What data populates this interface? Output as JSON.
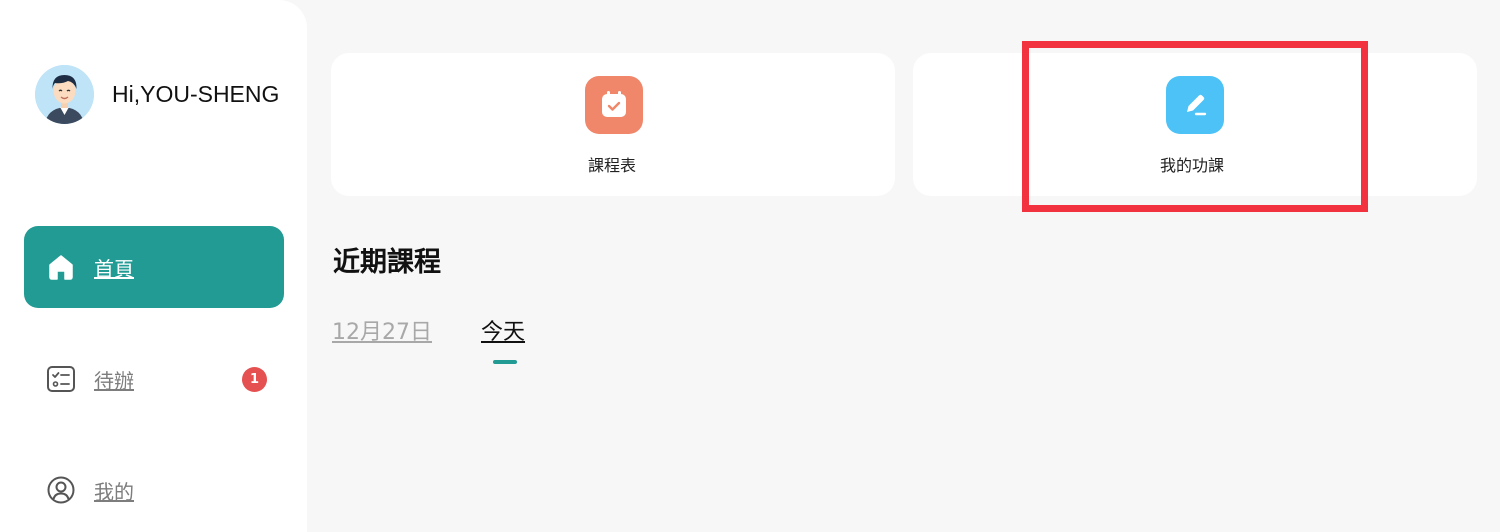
{
  "sidebar": {
    "greeting": "Hi,YOU-SHENG",
    "items": [
      {
        "label": "首頁",
        "icon": "home-icon",
        "active": true
      },
      {
        "label": "待辦",
        "icon": "checklist-icon",
        "badge": "1"
      },
      {
        "label": "我的",
        "icon": "user-icon"
      }
    ]
  },
  "quick_links": [
    {
      "label": "課程表",
      "icon": "calendar-check-icon",
      "color": "#f0876a"
    },
    {
      "label": "我的功課",
      "icon": "pencil-icon",
      "color": "#4cc2f6"
    }
  ],
  "recent_courses": {
    "title": "近期課程",
    "tabs": [
      "12月27日",
      "今天"
    ],
    "active_tab": "今天"
  },
  "colors": {
    "accent": "#239b95",
    "highlight": "#f2323f",
    "badge": "#e55050"
  }
}
